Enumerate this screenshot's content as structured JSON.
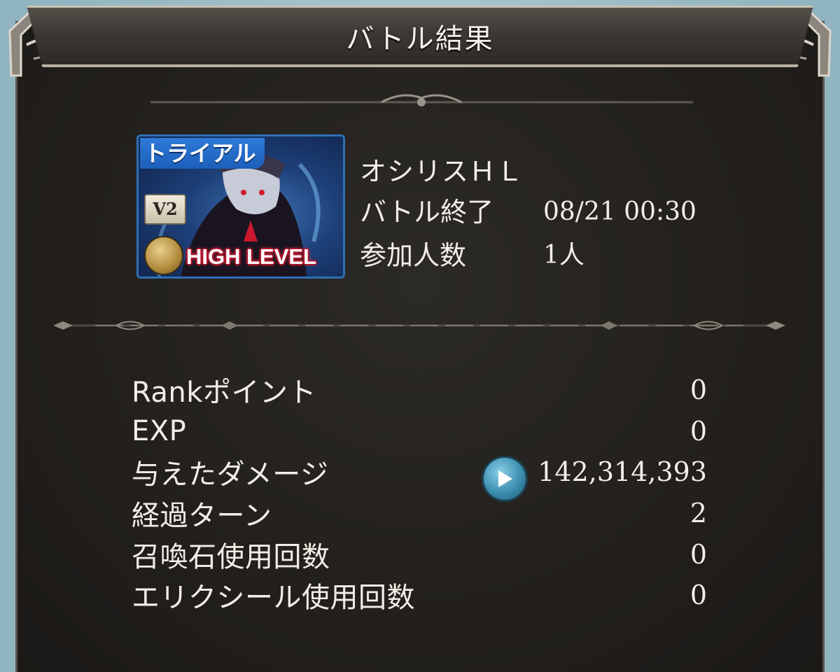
{
  "header": {
    "title": "バトル結果"
  },
  "quest": {
    "banner_tag": "トライアル",
    "banner_badge": "V2",
    "banner_level": "HIGH LEVEL",
    "name": "オシリスＨＬ",
    "end_label": "バトル終了",
    "end_time": "08/21 00:30",
    "participants_label": "参加人数",
    "participants_value": "1人"
  },
  "stats": [
    {
      "label": "Rankポイント",
      "value": "0"
    },
    {
      "label": "EXP",
      "value": "0"
    },
    {
      "label": "与えたダメージ",
      "value": "142,314,393"
    },
    {
      "label": "経過ターン",
      "value": "2"
    },
    {
      "label": "召喚石使用回数",
      "value": "0"
    },
    {
      "label": "エリクシール使用回数",
      "value": "0"
    }
  ],
  "icons": {
    "damage_detail": "play-icon",
    "emblem": "star-emblem-icon"
  },
  "colors": {
    "panel_bg": "#221f1c",
    "text": "#f2eee6",
    "banner_blue": "#1d3f78",
    "play_button": "#3c8eb0",
    "highlight_red": "#b0142a"
  }
}
